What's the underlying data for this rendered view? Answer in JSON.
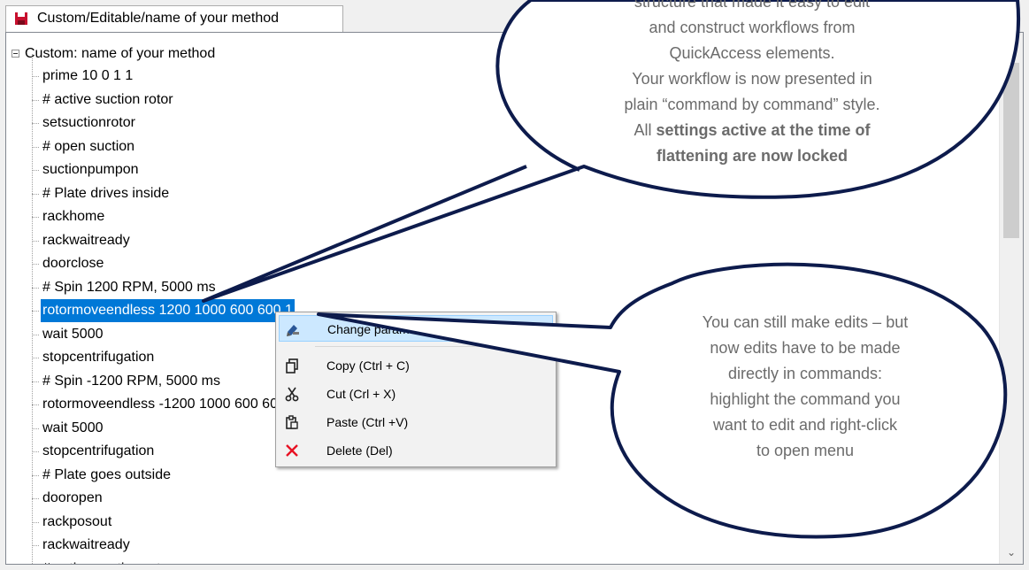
{
  "tab": {
    "title": "Custom/Editable/name of your method",
    "icon": "save-icon"
  },
  "tree": {
    "root_label": "Custom: name of your method",
    "selected_index": 10,
    "items": [
      "prime 10 0 1 1",
      "# active suction rotor",
      "setsuctionrotor",
      "# open suction",
      "suctionpumpon",
      "# Plate drives inside",
      "rackhome",
      "rackwaitready",
      "doorclose",
      "# Spin 1200 RPM, 5000 ms",
      "rotormoveendless 1200 1000 600 600 1",
      "wait 5000",
      "stopcentrifugation",
      "# Spin -1200 RPM, 5000 ms",
      "rotormoveendless -1200 1000 600 600 1",
      "wait 5000",
      "stopcentrifugation",
      "# Plate goes outside",
      "dooropen",
      "rackposout",
      "rackwaitready",
      "# active suction rotor"
    ]
  },
  "context_menu": {
    "items": [
      {
        "label": "Change parameter",
        "icon": "edit-parameter-icon"
      },
      {
        "label": "Copy (Ctrl + C)",
        "icon": "copy-icon"
      },
      {
        "label": "Cut (Crl + X)",
        "icon": "scissors-icon"
      },
      {
        "label": "Paste (Ctrl +V)",
        "icon": "paste-icon"
      },
      {
        "label": "Delete (Del)",
        "icon": "delete-x-icon"
      }
    ]
  },
  "callouts": {
    "top": {
      "line1": "structure that made it easy to edit",
      "line2": "and construct workflows from",
      "line3": "QuickAccess elements.",
      "line4": "Your workflow is now presented in",
      "line5": "plain “command by command” style.",
      "line6_prefix": "All ",
      "line6_bold": "settings active at the time of",
      "line7_bold": "flattening are now locked"
    },
    "bottom": {
      "line1": "You can still make edits – but",
      "line2": "now edits have to be made",
      "line3": "directly in commands:",
      "line4": "highlight the command you",
      "line5": "want to edit and right-click",
      "line6": "to open menu"
    }
  },
  "colors": {
    "selection": "#0078d7",
    "callout_border": "#0d1b4c",
    "delete_icon": "#e81123",
    "save_icon": "#c8102e",
    "menu_highlight": "#cce8ff"
  }
}
